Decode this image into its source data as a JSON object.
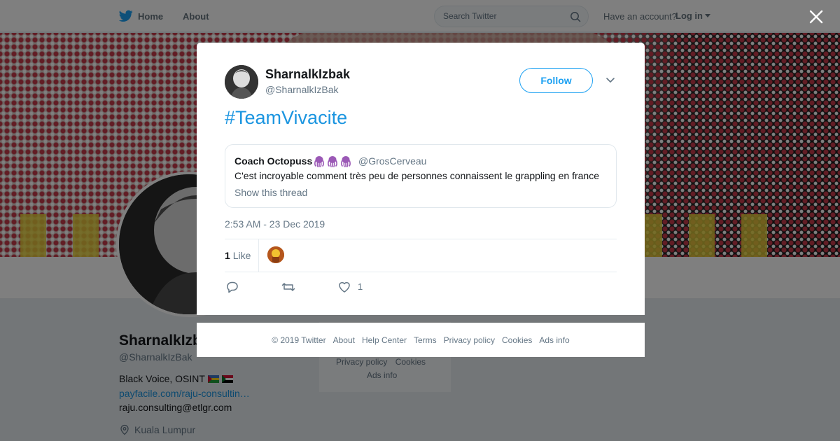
{
  "topbar": {
    "home_label": "Home",
    "about_label": "About",
    "search_placeholder": "Search Twitter",
    "have_account": "Have an account?",
    "login_label": "Log in"
  },
  "profile": {
    "name": "SharnalkIzbak",
    "handle": "@SharnalkIzBak",
    "bio": "Black Voice, OSINT",
    "link": "payfacile.com/raju-consultin…",
    "email": "raju.consulting@etlgr.com",
    "location": "Kuala Lumpur"
  },
  "side_footer": {
    "privacy": "Privacy policy",
    "cookies": "Cookies",
    "ads": "Ads info"
  },
  "tweet": {
    "author_name": "SharnalkIzbak",
    "author_handle": "@SharnalkIzBak",
    "follow_label": "Follow",
    "text": "#TeamVivacite",
    "timestamp": "2:53 AM - 23 Dec 2019",
    "likes_number": "1",
    "likes_word": "Like",
    "like_action_count": "1",
    "quoted": {
      "name": "Coach Octopuss",
      "handle": "@GrosCerveau",
      "text": "C'est incroyable comment très peu de personnes connaissent le grappling en france",
      "thread_label": "Show this thread"
    }
  },
  "footer": {
    "copyright": "© 2019 Twitter",
    "about": "About",
    "help": "Help Center",
    "terms": "Terms",
    "privacy": "Privacy policy",
    "cookies": "Cookies",
    "ads": "Ads info"
  },
  "colors": {
    "twitter_blue": "#1da1f2",
    "link_blue": "#1b95e0",
    "text_secondary": "#657786"
  },
  "icons": [
    "twitter-bird-icon",
    "search-icon",
    "close-icon",
    "chevron-down-icon",
    "reply-icon",
    "retweet-icon",
    "heart-icon",
    "location-icon",
    "octopus-icon"
  ]
}
